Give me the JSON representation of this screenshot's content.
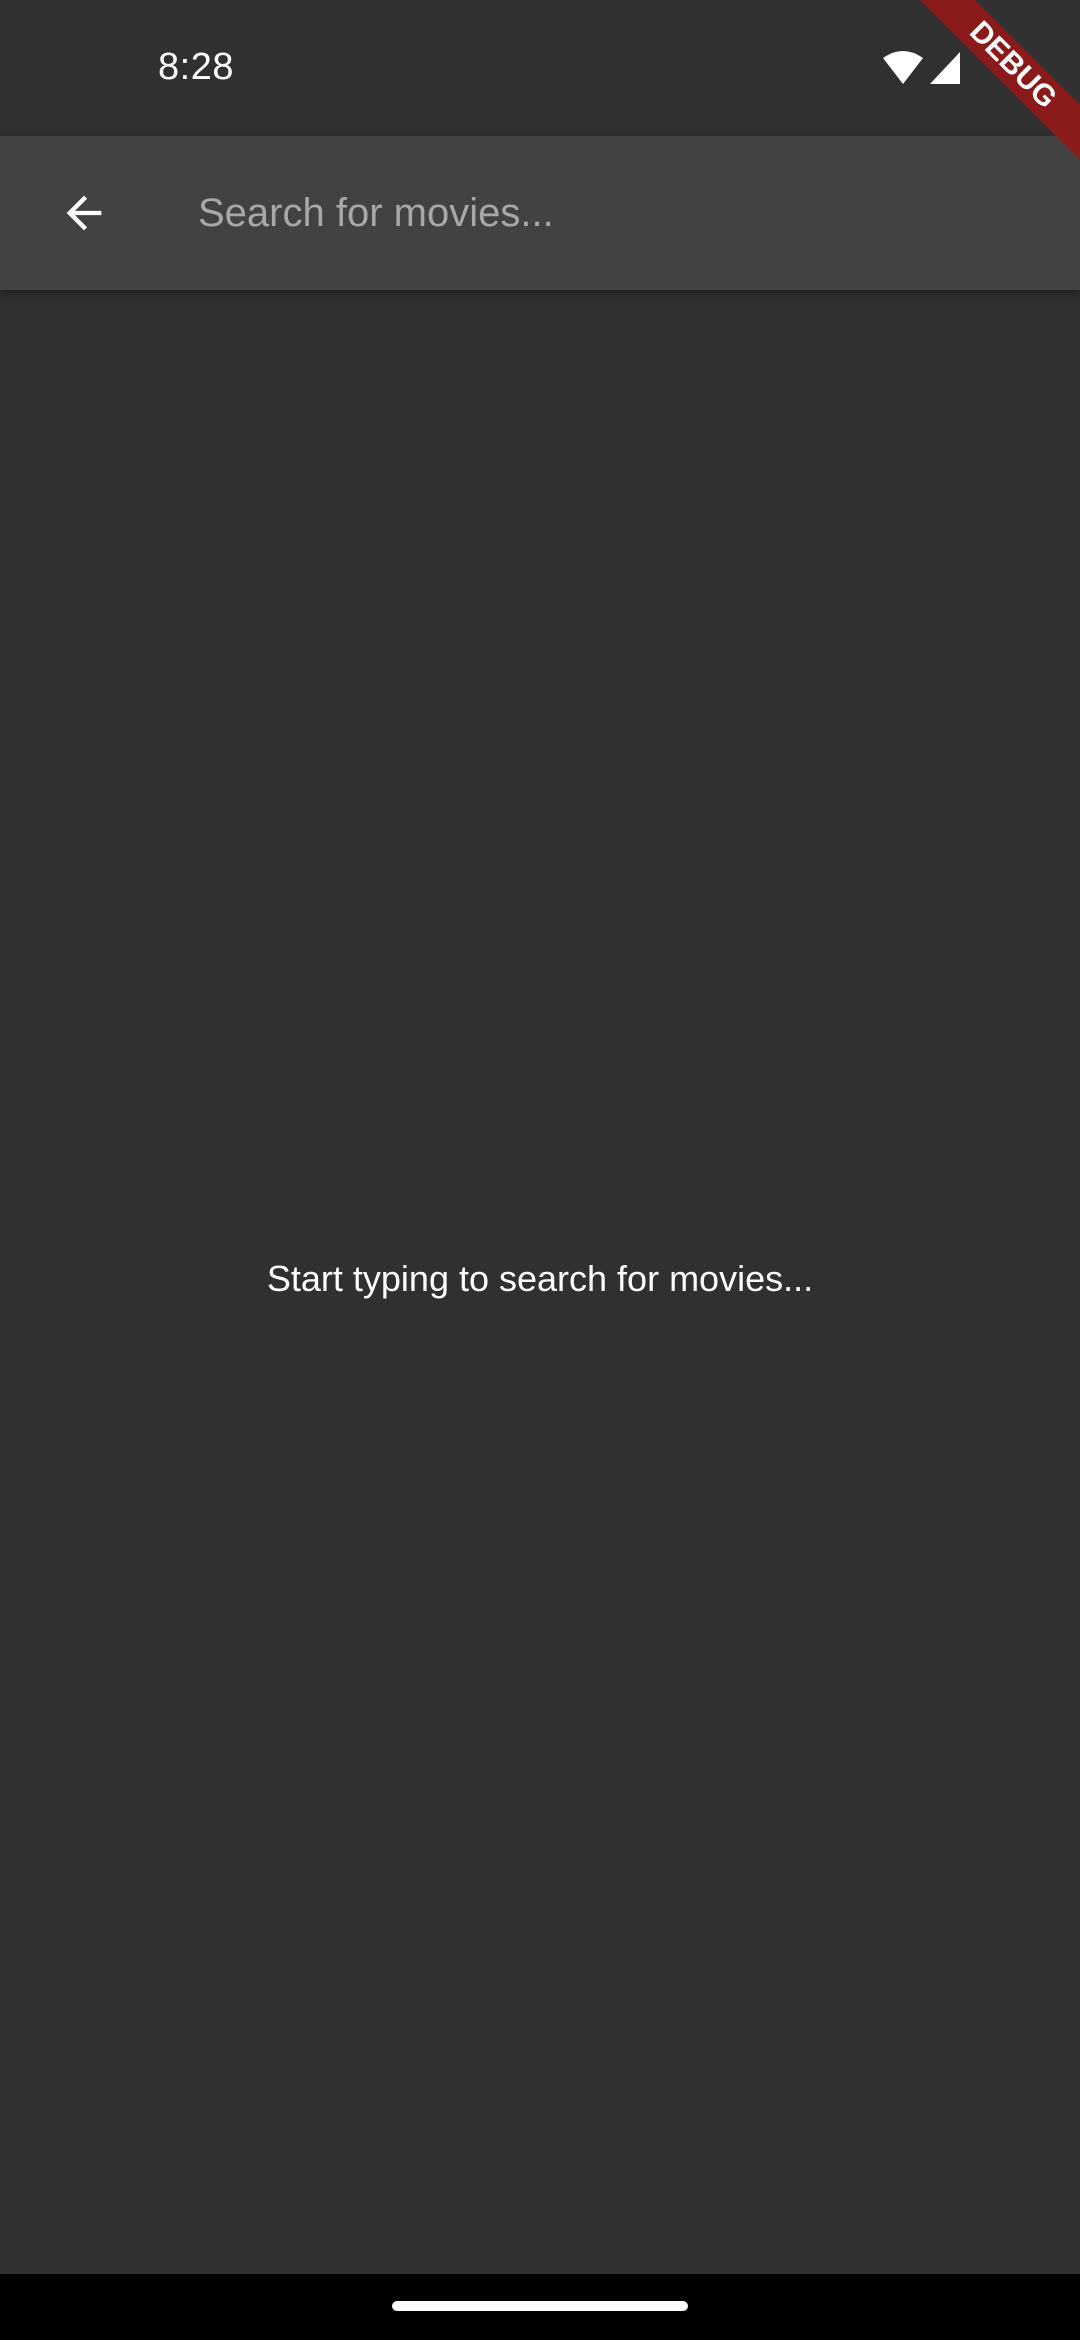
{
  "status_bar": {
    "time": "8:28",
    "icons": [
      "wifi-icon",
      "cellular-signal-icon"
    ]
  },
  "app_bar": {
    "back_icon": "arrow-back-icon",
    "search": {
      "value": "",
      "placeholder": "Search for movies..."
    }
  },
  "main": {
    "empty_message": "Start typing to search for movies..."
  },
  "debug_banner": {
    "label": "DEBUG",
    "color": "#8b1a1a"
  },
  "colors": {
    "background": "#303030",
    "app_bar": "#424242",
    "text": "#ffffff",
    "placeholder": "#a8a8a8"
  }
}
